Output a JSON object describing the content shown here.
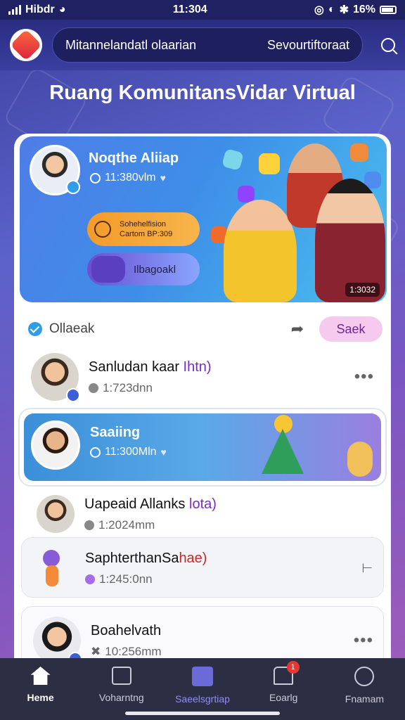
{
  "status_bar": {
    "carrier": "Hibdr",
    "time": "11:304",
    "battery": "16%"
  },
  "top_bar": {
    "search_left": "Mitannelandatl olaarian",
    "search_right": "Sevourtiftoraat"
  },
  "page_title": "Ruang KomunitansVidar Virtual",
  "hero": {
    "name": "Noqthe Aliiap",
    "time": "11:380vlm",
    "button1_line1": "Sohehelfision",
    "button1_line2": "Cartom BP:309",
    "button2_label": "Ilbagoakl",
    "corner_badge": "1:3032"
  },
  "online_row": {
    "label": "Ollaeak",
    "seek_label": "Saek"
  },
  "rows": [
    {
      "name": "Sanludan kaar",
      "tag": "Ihtn)",
      "time": "1:723dnn"
    },
    {
      "name": "Saaiing",
      "time": "11:300Mln"
    },
    {
      "name": "Uapeaid Allanks",
      "tag": "lota)",
      "time": "1:2024mm"
    },
    {
      "name": "SaphterthanSa",
      "tag": "hae)",
      "time": "1:245:0nn"
    },
    {
      "name": "Boahelvath",
      "time": "10:256mm"
    }
  ],
  "bottom_nav": [
    {
      "label": "Heme"
    },
    {
      "label": "Voharntng"
    },
    {
      "label": "Saeelsgrtiap"
    },
    {
      "label": "Eoarlg",
      "badge": "1"
    },
    {
      "label": "Fnamam"
    }
  ],
  "colors": {
    "accent": "#3c5fd8",
    "hero": "#4e7de8",
    "seek": "#f6c9ef",
    "nav_bg": "#2c2f44",
    "nav_active": "#8f8cf5"
  }
}
